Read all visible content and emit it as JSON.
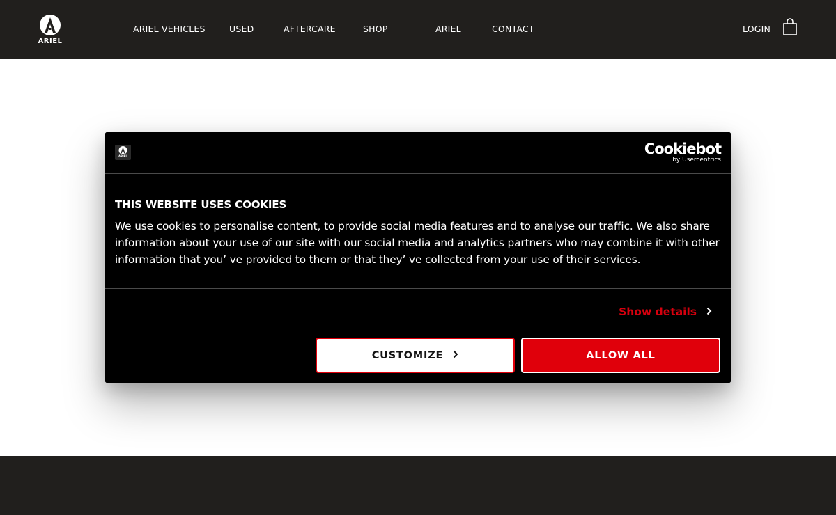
{
  "header": {
    "brand_label": "ARIEL",
    "nav": [
      {
        "label": "ARIEL VEHICLES"
      },
      {
        "label": "USED"
      },
      {
        "label": "AFTERCARE"
      },
      {
        "label": "SHOP"
      },
      {
        "label": "ARIEL"
      },
      {
        "label": "CONTACT"
      }
    ],
    "login_label": "LOGIN",
    "cart_icon": "shopping-bag-icon"
  },
  "cookie_dialog": {
    "logo_label": "ARIEL",
    "provider_name": "Cookiebot",
    "provider_sub": "by Usercentrics",
    "title": "THIS WEBSITE USES COOKIES",
    "body": "We use cookies to personalise content, to provide social media features and to analyse our traffic. We also share information about your use of our site with our social media and analytics partners who may combine it with other information that you’ ve provided to them or that they’ ve collected from your use of their services.",
    "show_details_label": "Show details",
    "customize_label": "CUSTOMIZE",
    "allow_all_label": "ALLOW ALL"
  },
  "colors": {
    "header_bg": "#211f1d",
    "accent_red": "#e0000b",
    "dialog_bg": "#000000"
  }
}
